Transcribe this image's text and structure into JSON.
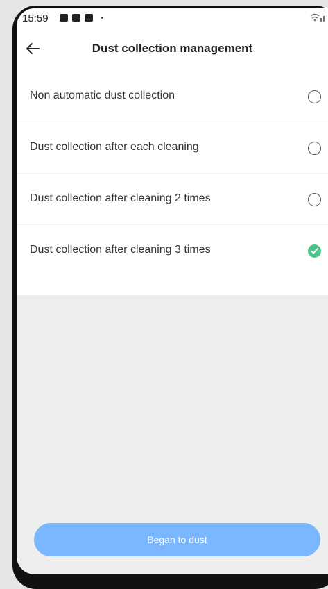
{
  "status_bar": {
    "time": "15:59",
    "icons_left": [
      "folder-icon",
      "image-icon",
      "flipboard-icon",
      "dot-icon"
    ],
    "icons_right": "wifi-signal-icon"
  },
  "header": {
    "title": "Dust collection management",
    "back_icon": "arrow-left-icon"
  },
  "options": [
    {
      "label": "Non automatic dust collection",
      "selected": false
    },
    {
      "label": "Dust collection after each cleaning",
      "selected": false
    },
    {
      "label": "Dust collection after cleaning 2 times",
      "selected": false
    },
    {
      "label": "Dust collection after cleaning 3 times",
      "selected": true
    }
  ],
  "footer": {
    "button_label": "Began to dust"
  },
  "colors": {
    "accent_check": "#4cc48c",
    "button_bg": "#7ab7ff",
    "page_bg": "#eeeeee"
  }
}
